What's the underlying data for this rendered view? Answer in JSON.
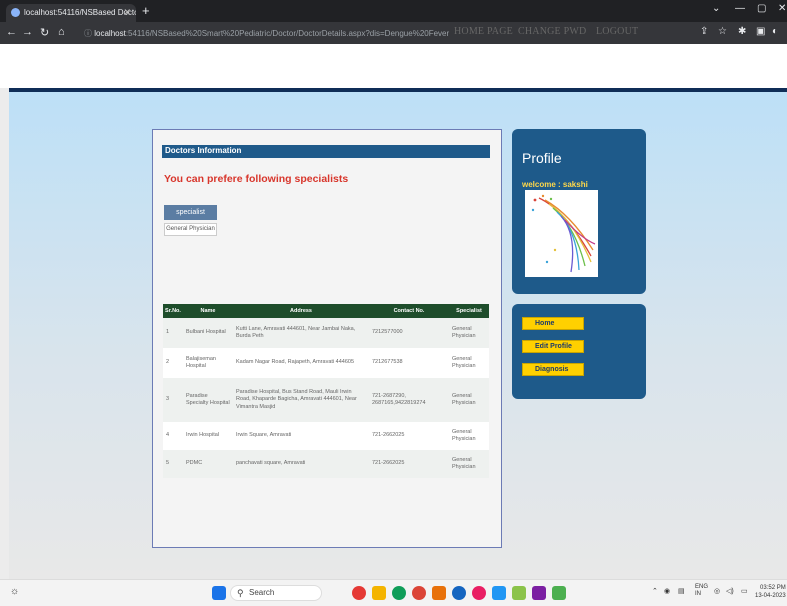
{
  "browser": {
    "tab_title": "localhost:54116/NSBased Docto...",
    "url_host": "localhost",
    "url_path": ":54116/NSBased%20Smart%20Pediatric/Doctor/DoctorDetails.aspx?dis=Dengue%20Fever"
  },
  "nav": {
    "home": "HOME PAGE",
    "change_pwd": "CHANGE PWD",
    "logout": "LOGOUT"
  },
  "content": {
    "info_title": "Doctors Information",
    "prefer_text": "You can prefere following specialists",
    "specialist_button": "specialist",
    "specialist_item": "General Physician"
  },
  "table": {
    "headers": [
      "Sr.No.",
      "Name",
      "Address",
      "Contact No.",
      "Specialist"
    ],
    "rows": [
      [
        "1",
        "Bulbani Hospital",
        "Kutti Lane, Amravati 444601, Near Jambai Naka, Burda Peth",
        "7212577000",
        "General Physician"
      ],
      [
        "2",
        "Balajiseman Hospital",
        "Kadam Nagar Road, Rajapeth, Amravati 444605",
        "7212677538",
        "General Physician"
      ],
      [
        "3",
        "Paradise Specialty Hospital",
        "Paradise Hospital, Bus Stand Road, Mauli Irwin Road, Khaparde Bagicha, Amravati 444601, Near Vimantra Masjid",
        "721-2687290, 2687165,9422819274",
        "General Physician"
      ],
      [
        "4",
        "Irwin Hospital",
        "Irwin Square, Amravati",
        "721-2662025",
        "General Physician"
      ],
      [
        "5",
        "PDMC",
        "panchavati square, Amravati",
        "721-2662025",
        "General Physician"
      ]
    ]
  },
  "profile": {
    "title": "Profile",
    "welcome": "welcome : sakshi"
  },
  "menu": {
    "home": "Home",
    "edit_profile": "Edit Profile",
    "diagnosis": "Diagnosis"
  },
  "taskbar": {
    "search": "Search",
    "lang_top": "ENG",
    "lang_bottom": "IN",
    "time": "03:52 PM",
    "date": "13-04-2023"
  },
  "colors": {
    "header_bar": "#0f2d57",
    "panel": "#1e5a8a",
    "accent_yellow": "#ffd000",
    "table_header": "#1e4d2b",
    "alert_red": "#d8362c"
  }
}
